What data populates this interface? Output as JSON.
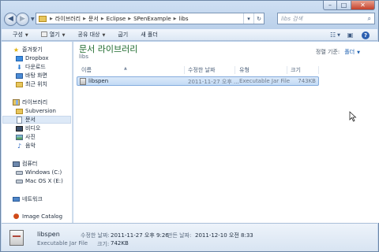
{
  "window": {
    "address": {
      "crumbs": [
        "라이브러리",
        "문서",
        "Eclipse",
        "SPenExample",
        "libs"
      ]
    },
    "search": {
      "placeholder": "libs 검색"
    }
  },
  "toolbar": {
    "organize": "구성",
    "open": "열기",
    "share": "공유 대상",
    "burn": "굽기",
    "new_folder": "새 폴더"
  },
  "sidebar": {
    "favorites": "즐겨찾기",
    "dropbox": "Dropbox",
    "downloads": "다운로드",
    "desktop": "바탕 화면",
    "recent": "최근 위치",
    "libraries": "라이브러리",
    "subversion": "Subversion",
    "documents": "문서",
    "videos": "비디오",
    "pictures": "사진",
    "music": "음악",
    "computer": "컴퓨터",
    "windows_c": "Windows (C:)",
    "mac_e": "Mac OS X (E:)",
    "network": "네트워크",
    "image_catalog": "Image Catalog"
  },
  "content": {
    "library_title": "문서 라이브러리",
    "library_sub": "libs",
    "arrange_label": "정렬 기준:",
    "arrange_value": "폴더",
    "columns": {
      "name": "이름",
      "modified": "수정한 날짜",
      "type": "유형",
      "size": "크기"
    },
    "files": [
      {
        "name": "libspen",
        "modified": "2011-11-27 오후 ...",
        "type": "Executable Jar File",
        "size": "743KB"
      }
    ]
  },
  "details": {
    "name": "libspen",
    "type": "Executable Jar File",
    "modified_label": "수정한 날짜:",
    "modified_value": "2011-11-27 오후 9:26",
    "created_label": "만든 날짜:",
    "created_value": "2011-12-10 오전 8:33",
    "size_label": "크기:",
    "size_value": "742KB"
  },
  "icons": {
    "back": "back-arrow-icon",
    "forward": "forward-arrow-icon",
    "refresh": "refresh-icon",
    "search": "magnifier-icon",
    "views": "views-icon",
    "preview": "preview-pane-icon",
    "help": "help-icon"
  }
}
